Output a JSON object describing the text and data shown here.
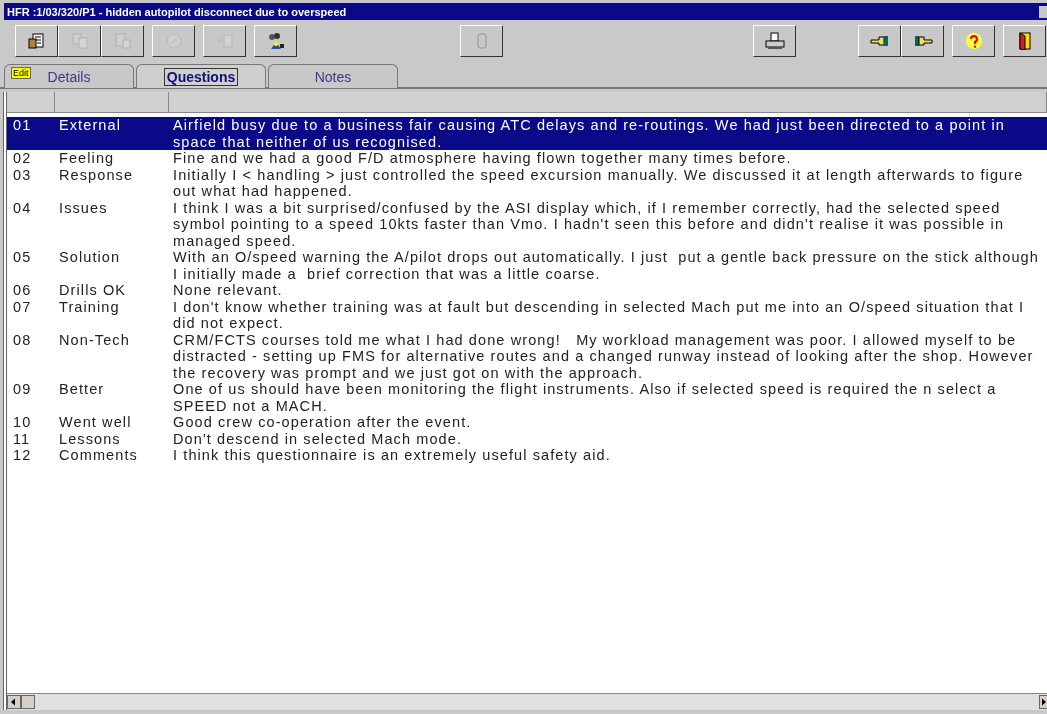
{
  "window": {
    "title": "HFR :1/03/320/P1 - hidden autopilot disconnect due to overspeed"
  },
  "toolbar": [
    {
      "kind": "edit",
      "disabled": false
    },
    {
      "kind": "copy",
      "disabled": true
    },
    {
      "kind": "paste",
      "disabled": true
    },
    {
      "kind": "disc",
      "disabled": true
    },
    {
      "kind": "add",
      "disabled": true
    },
    {
      "kind": "people",
      "disabled": false
    },
    {
      "kind": "blank",
      "disabled": true
    },
    {
      "kind": "print",
      "disabled": false
    },
    {
      "kind": "prev",
      "disabled": false
    },
    {
      "kind": "next",
      "disabled": false
    },
    {
      "kind": "help",
      "disabled": false
    },
    {
      "kind": "exit",
      "disabled": false
    }
  ],
  "tabs": [
    {
      "label": "Details",
      "badge": "Edit",
      "selected": false
    },
    {
      "label": "Questions",
      "selected": true
    },
    {
      "label": "Notes",
      "selected": false
    }
  ],
  "table": {
    "rows": [
      {
        "number": "01",
        "topic": "External",
        "answer": "Airfield busy due to a business fair causing ATC delays and re-routings. We had just been directed to a point in space that neither of us recognised.",
        "selected": true
      },
      {
        "number": "02",
        "topic": "Feeling",
        "answer": "Fine and we had a good F/D atmosphere having flown together many times before.",
        "selected": false
      },
      {
        "number": "03",
        "topic": "Response",
        "answer": "Initially I < handling > just controlled the speed excursion manually. We discussed it at length afterwards to figure out what had happened.",
        "selected": false
      },
      {
        "number": "04",
        "topic": "Issues",
        "answer": "I think I was a bit surprised/confused by the ASI display which, if I remember correctly, had the selected speed symbol pointing to a speed 10kts faster than Vmo. I hadn't seen this before and didn't realise it was possible in managed speed.",
        "selected": false
      },
      {
        "number": "05",
        "topic": "Solution",
        "answer": "With an O/speed warning the A/pilot drops out automatically. I just  put a gentle back pressure on the stick although I initially made a  brief correction that was a little coarse.",
        "selected": false
      },
      {
        "number": "06",
        "topic": "Drills OK",
        "answer": "None relevant.",
        "selected": false
      },
      {
        "number": "07",
        "topic": "Training",
        "answer": "I don't know whether training was at fault but descending in selected Mach put me into an O/speed situation that I did not expect.",
        "selected": false
      },
      {
        "number": "08",
        "topic": "Non-Tech",
        "answer": "CRM/FCTS courses told me what I had done wrong!   My workload management was poor. I allowed myself to be distracted - setting up FMS for alternative routes and a changed runway instead of looking after the shop. However the recovery was prompt and we just got on with the approach.",
        "selected": false
      },
      {
        "number": "09",
        "topic": "Better",
        "answer": "One of us should have been monitoring the flight instruments. Also if selected speed is required the n select a SPEED not a MACH.",
        "selected": false
      },
      {
        "number": "10",
        "topic": "Went well",
        "answer": "Good crew co-operation after the event.",
        "selected": false
      },
      {
        "number": "11",
        "topic": "Lessons",
        "answer": "Don't descend in selected Mach mode.",
        "selected": false
      },
      {
        "number": "12",
        "topic": "Comments",
        "answer": "I think this questionnaire is an extremely useful safety aid.",
        "selected": false
      }
    ]
  }
}
